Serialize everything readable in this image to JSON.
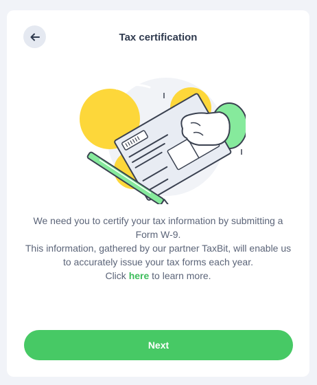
{
  "header": {
    "title": "Tax certification",
    "back_icon": "arrow-left-icon"
  },
  "illustration": {
    "icon": "tax-form-signing-illustration",
    "colors": {
      "accent_yellow": "#fdd73a",
      "accent_green": "#86ea9c",
      "paper": "#e8ecf3",
      "outline": "#3a4150"
    }
  },
  "content": {
    "line1": "We need you to certify your tax information by submitting a Form W-9.",
    "line2": "This information, gathered by our partner TaxBit, will enable us to accurately issue your tax forms each year.",
    "line3_prefix": "Click ",
    "line3_link": "here",
    "line3_suffix": " to learn more."
  },
  "footer": {
    "next_label": "Next"
  },
  "colors": {
    "primary": "#47c965",
    "link": "#3ebd5c",
    "text": "#5b6478",
    "title": "#2f3a4e"
  }
}
